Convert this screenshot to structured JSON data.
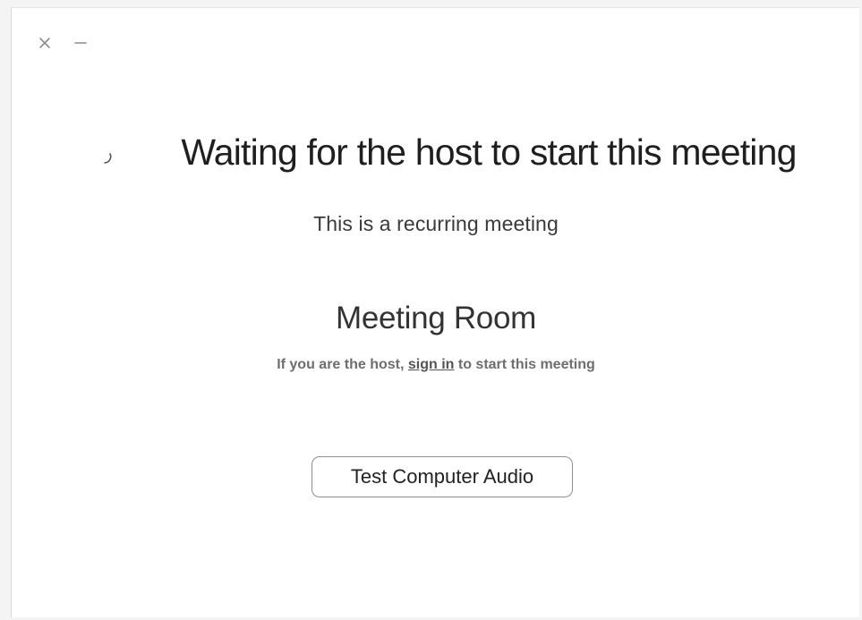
{
  "window": {
    "controls": {
      "close_icon": "close-icon",
      "minimize_icon": "minimize-icon"
    }
  },
  "main": {
    "title": "Waiting for the host to start this meeting",
    "subtitle": "This is a recurring meeting",
    "room_name": "Meeting Room",
    "host_prompt": {
      "prefix": "If you are the host, ",
      "link": "sign in",
      "suffix": " to start this meeting"
    },
    "audio_button_label": "Test Computer Audio"
  },
  "colors": {
    "text_primary": "#1f1f1f",
    "text_secondary": "#3a3a3a",
    "text_muted": "#6e6e6e",
    "button_border": "#8e8e8e"
  }
}
